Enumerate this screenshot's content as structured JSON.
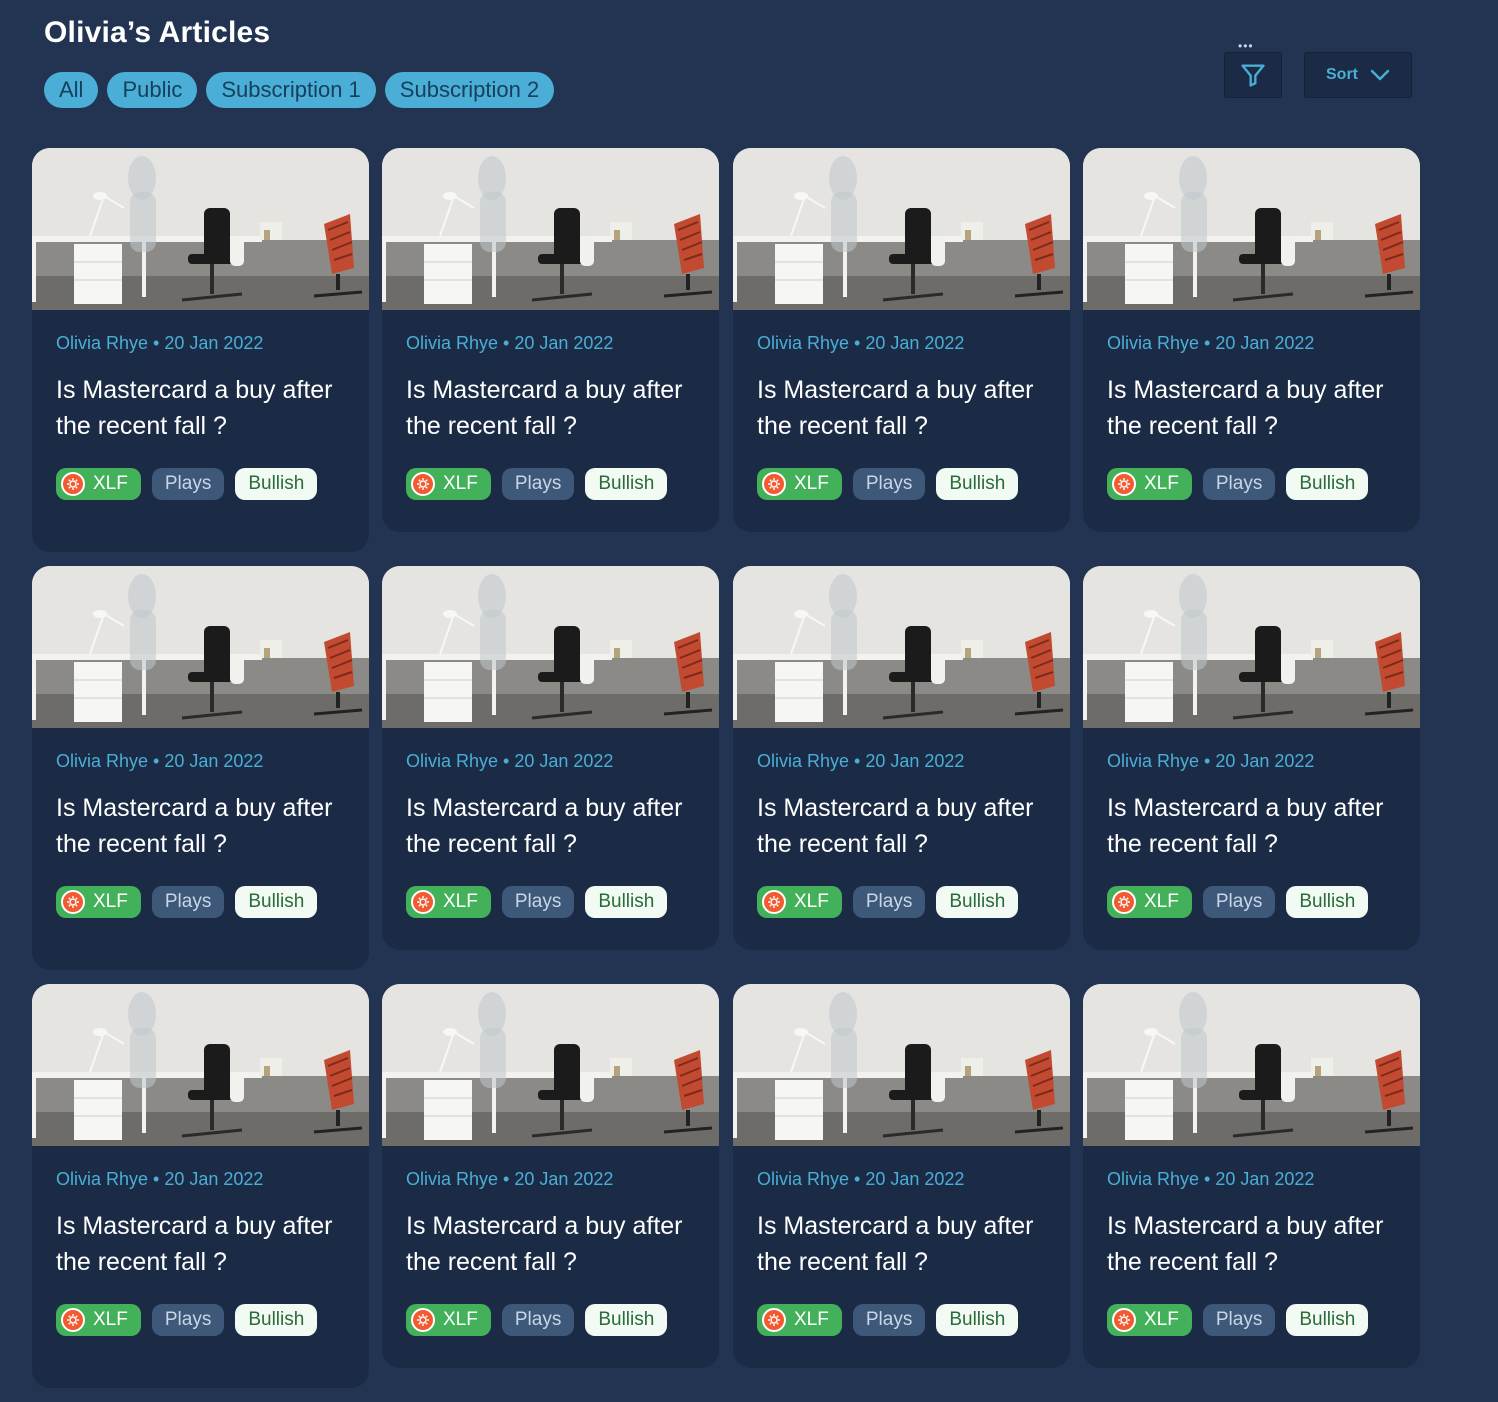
{
  "page": {
    "title": "Olivia’s Articles",
    "filters": [
      "All",
      "Public",
      "Subscription 1",
      "Subscription 2"
    ],
    "filter_icon": "funnel-icon",
    "filter_dots": "•••",
    "sort_label": "Sort",
    "sort_icon": "chevron-down-icon",
    "accent_color": "#4aaed6",
    "background_color": "#223452",
    "card_color": "#1b2b46"
  },
  "articles": [
    {
      "author_date": "Olivia Rhye • 20 Jan 2022",
      "title": "Is Mastercard a buy after the recent fall ?",
      "tags": [
        "XLF",
        "Plays",
        "Bullish"
      ]
    },
    {
      "author_date": "Olivia Rhye • 20 Jan 2022",
      "title": "Is Mastercard a buy after the recent fall ?",
      "tags": [
        "XLF",
        "Plays",
        "Bullish"
      ]
    },
    {
      "author_date": "Olivia Rhye • 20 Jan 2022",
      "title": "Is Mastercard a buy after the recent fall ?",
      "tags": [
        "XLF",
        "Plays",
        "Bullish"
      ]
    },
    {
      "author_date": "Olivia Rhye • 20 Jan 2022",
      "title": "Is Mastercard a buy after the recent fall ?",
      "tags": [
        "XLF",
        "Plays",
        "Bullish"
      ]
    },
    {
      "author_date": "Olivia Rhye • 20 Jan 2022",
      "title": "Is Mastercard a buy after the recent fall ?",
      "tags": [
        "XLF",
        "Plays",
        "Bullish"
      ]
    },
    {
      "author_date": "Olivia Rhye • 20 Jan 2022",
      "title": "Is Mastercard a buy after the recent fall ?",
      "tags": [
        "XLF",
        "Plays",
        "Bullish"
      ]
    },
    {
      "author_date": "Olivia Rhye • 20 Jan 2022",
      "title": "Is Mastercard a buy after the recent fall ?",
      "tags": [
        "XLF",
        "Plays",
        "Bullish"
      ]
    },
    {
      "author_date": "Olivia Rhye • 20 Jan 2022",
      "title": "Is Mastercard a buy after the recent fall ?",
      "tags": [
        "XLF",
        "Plays",
        "Bullish"
      ]
    },
    {
      "author_date": "Olivia Rhye • 20 Jan 2022",
      "title": "Is Mastercard a buy after the recent fall ?",
      "tags": [
        "XLF",
        "Plays",
        "Bullish"
      ]
    },
    {
      "author_date": "Olivia Rhye • 20 Jan 2022",
      "title": "Is Mastercard a buy after the recent fall ?",
      "tags": [
        "XLF",
        "Plays",
        "Bullish"
      ]
    },
    {
      "author_date": "Olivia Rhye • 20 Jan 2022",
      "title": "Is Mastercard a buy after the recent fall ?",
      "tags": [
        "XLF",
        "Plays",
        "Bullish"
      ]
    },
    {
      "author_date": "Olivia Rhye • 20 Jan 2022",
      "title": "Is Mastercard a buy after the recent fall ?",
      "tags": [
        "XLF",
        "Plays",
        "Bullish"
      ]
    }
  ]
}
